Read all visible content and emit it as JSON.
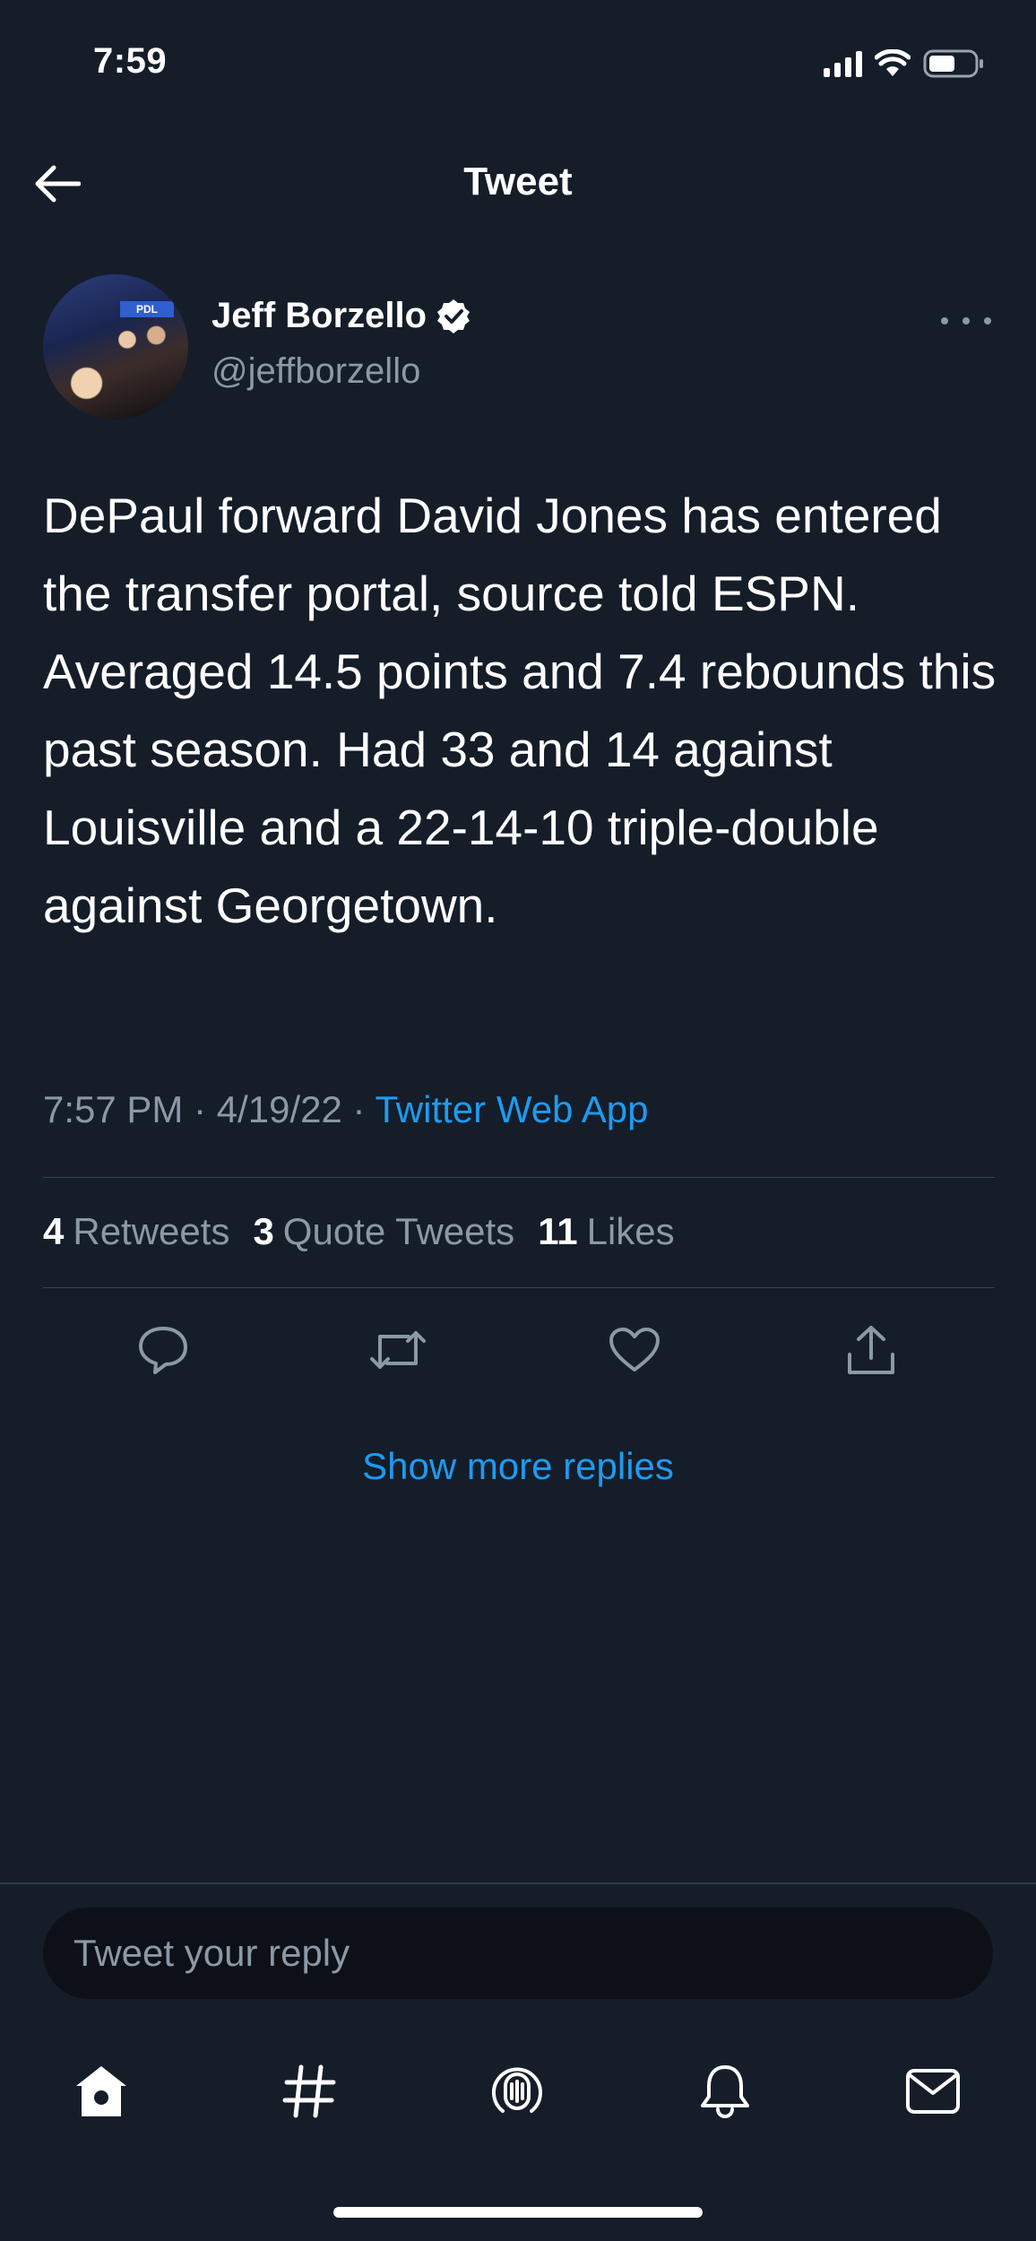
{
  "status_bar": {
    "time": "7:59",
    "icons": [
      "signal-icon",
      "wifi-icon",
      "battery-icon"
    ]
  },
  "header": {
    "title": "Tweet",
    "back_icon": "arrow-left-icon"
  },
  "tweet": {
    "author": {
      "name": "Jeff Borzello",
      "handle": "@jeffborzello",
      "verified": true
    },
    "text": "DePaul forward David Jones has entered the transfer portal, source told ESPN. Averaged 14.5 points and 7.4 rebounds this past season. Had 33 and 14 against Louisville and a 22-14-10 triple-double against Georgetown.",
    "time": "7:57 PM",
    "date": "4/19/22",
    "separator": " · ",
    "source": "Twitter Web App",
    "stats": {
      "retweets_count": "4",
      "retweets_label": "Retweets",
      "quotes_count": "3",
      "quotes_label": "Quote Tweets",
      "likes_count": "11",
      "likes_label": "Likes"
    },
    "actions": [
      "reply-icon",
      "retweet-icon",
      "like-icon",
      "share-icon"
    ]
  },
  "show_more_replies": "Show more replies",
  "reply": {
    "placeholder": "Tweet your reply"
  },
  "tab_bar": [
    "home-icon",
    "explore-hashtag-icon",
    "spaces-icon",
    "notifications-bell-icon",
    "messages-envelope-icon"
  ],
  "colors": {
    "background": "#151d29",
    "accent": "#1d9bf0",
    "secondary_text": "#8b98a5"
  }
}
